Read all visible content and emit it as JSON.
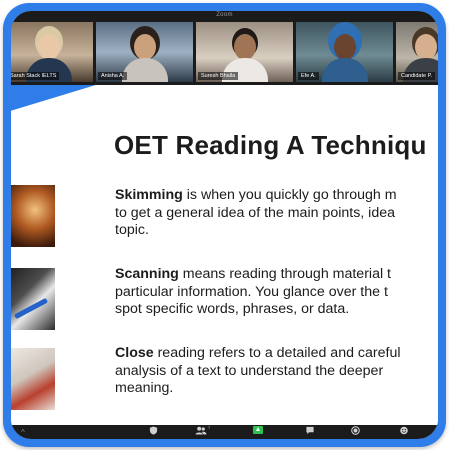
{
  "meeting": {
    "title": "Zoom",
    "participants": [
      {
        "name": "Sarah Stack IELTS"
      },
      {
        "name": "Anisha A."
      },
      {
        "name": "Suresh Bhalla"
      },
      {
        "name": "Efe A."
      },
      {
        "name": "Candidate P."
      }
    ]
  },
  "slide": {
    "title": "OET Reading A Techniqu",
    "paragraphs": [
      {
        "term": "Skimming",
        "line1_rest": " is when you quickly go through m",
        "line2": "to get a general idea of the main points, idea",
        "line3": "topic."
      },
      {
        "term": "Scanning",
        "line1_rest": " means reading through material t",
        "line2": "particular information. You glance over the t",
        "line3": "spot specific words, phrases, or data."
      },
      {
        "term": "Close",
        "line1_rest": " reading refers to a detailed and careful",
        "line2": "analysis of a text to understand the deeper",
        "line3": "meaning."
      }
    ],
    "images": [
      {
        "name": "open-book-image"
      },
      {
        "name": "pen-on-paper-image"
      },
      {
        "name": "highlighted-document-image"
      }
    ]
  },
  "toolbar": {
    "participant_count": "7",
    "buttons": [
      {
        "icon": "security-shield-icon"
      },
      {
        "icon": "participants-icon"
      },
      {
        "icon": "share-screen-icon"
      },
      {
        "icon": "chat-icon"
      },
      {
        "icon": "record-icon"
      },
      {
        "icon": "reactions-icon"
      }
    ]
  },
  "colors": {
    "frame": "#2f7de9",
    "share_green": "#2fbf4f",
    "toolbar_bg": "#1b1b1b"
  }
}
